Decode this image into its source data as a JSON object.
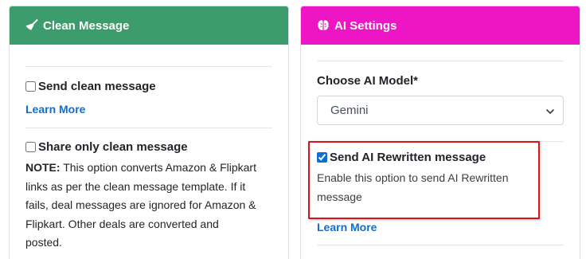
{
  "clean_card": {
    "title": "Clean Message",
    "icon": "broom-icon",
    "header_color": "#3c9c6c",
    "send_clean_label": "Send clean message",
    "send_clean_checked": false,
    "learn_more": "Learn More",
    "share_only_label": "Share only clean message",
    "share_only_checked": false,
    "note_prefix": "NOTE:",
    "note_lines": [
      " This option converts Amazon & Flipkart",
      "links as per the clean message template. If it",
      "fails, deal messages are ignored for Amazon &",
      "Flipkart. Other deals are converted and",
      "posted."
    ]
  },
  "ai_card": {
    "title": "AI Settings",
    "icon": "brain-icon",
    "header_color": "#ee15c4",
    "model_label": "Choose AI Model*",
    "model_selected": "Gemini",
    "rewrite_label": "Send AI Rewritten message",
    "rewrite_checked": true,
    "rewrite_help_lines": [
      "Enable this option to send AI Rewritten",
      "message"
    ],
    "learn_more": "Learn More"
  },
  "colors": {
    "link": "#0b6fd6",
    "highlight": "#d4161b"
  }
}
